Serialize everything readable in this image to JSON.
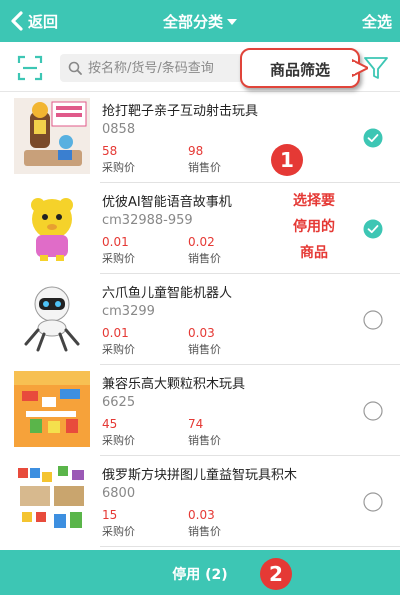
{
  "header": {
    "back_label": "返回",
    "title": "全部分类",
    "select_all_label": "全选",
    "bg_color": "#3dc6b4"
  },
  "search": {
    "placeholder": "按名称/货号/条码查询",
    "value": ""
  },
  "callout": {
    "label": "商品筛选"
  },
  "price_labels": {
    "purchase": "采购价",
    "sale": "销售价"
  },
  "products": [
    {
      "name": "抢打靶子亲子互动射击玩具",
      "code": "0858",
      "purchase_price": "58",
      "sale_price": "98",
      "selected": true
    },
    {
      "name": "优彼AI智能语音故事机",
      "code": "cm32988-959",
      "purchase_price": "0.01",
      "sale_price": "0.02",
      "selected": true
    },
    {
      "name": "六爪鱼儿童智能机器人",
      "code": "cm3299",
      "purchase_price": "0.01",
      "sale_price": "0.03",
      "selected": false
    },
    {
      "name": "兼容乐高大颗粒积木玩具",
      "code": "6625",
      "purchase_price": "45",
      "sale_price": "74",
      "selected": false
    },
    {
      "name": "俄罗斯方块拼图儿童益智玩具积木",
      "code": "6800",
      "purchase_price": "15",
      "sale_price": "0.03",
      "selected": false
    }
  ],
  "annotations": {
    "step1": "1",
    "step2": "2",
    "select_note_line1": "选择要",
    "select_note_line2": "停用的",
    "select_note_line3": "商品"
  },
  "footer": {
    "disable_label": "停用 (2)"
  },
  "colors": {
    "accent": "#3dc6b4",
    "price": "#e53935",
    "annotation": "#e53935"
  }
}
